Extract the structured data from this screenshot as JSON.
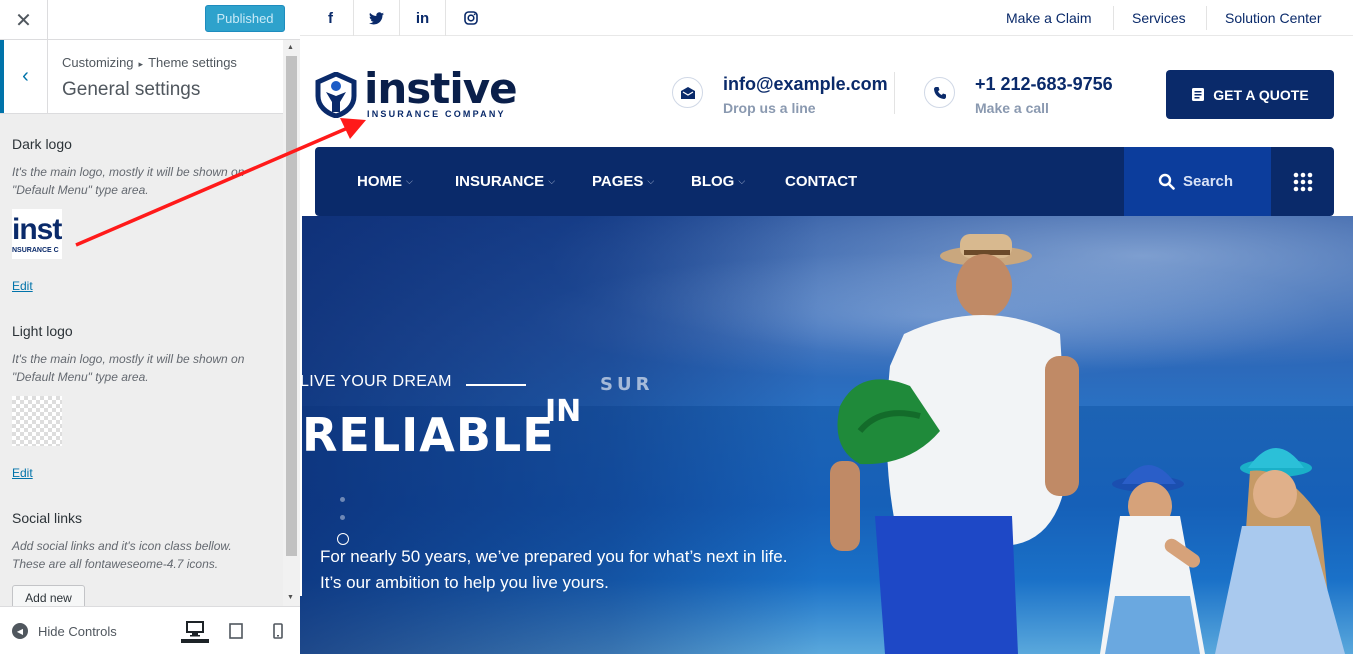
{
  "customizer": {
    "publish_label": "Published",
    "breadcrumb_parent": "Customizing",
    "breadcrumb_child": "Theme settings",
    "panel_title": "General settings",
    "sections": {
      "dark_logo_title": "Dark logo",
      "dark_logo_desc": "It's the main logo, mostly it will be shown on \"Default Menu\" type area.",
      "dark_logo_thumb_big": "insti",
      "dark_logo_thumb_small": "NSURANCE C",
      "light_logo_title": "Light logo",
      "light_logo_desc": "It's the main logo, mostly it will be shown on \"Default Menu\" type area.",
      "edit_label": "Edit",
      "social_title": "Social links",
      "social_desc": "Add social links and it's icon class bellow. These are all fontaweseome-4.7 icons.",
      "add_new_label": "Add new"
    },
    "footer": {
      "hide_controls_label": "Hide Controls"
    }
  },
  "site": {
    "social_icons": [
      "facebook-icon",
      "twitter-icon",
      "linkedin-icon",
      "instagram-icon"
    ],
    "social_glyphs": {
      "facebook": "f",
      "twitter": "🐦",
      "linkedin": "in",
      "instagram": "◎"
    },
    "top_links": [
      "Make a Claim",
      "Services",
      "Solution Center"
    ],
    "logo": {
      "word": "instive",
      "tagline": "INSURANCE COMPANY"
    },
    "contact": {
      "email": "info@example.com",
      "email_sub": "Drop us a line",
      "phone": "+1 212-683-9756",
      "phone_sub": "Make a call"
    },
    "quote_button": "GET A QUOTE",
    "nav": {
      "items": [
        "HOME",
        "INSURANCE",
        "PAGES",
        "BLOG",
        "CONTACT"
      ],
      "search_label": "Search"
    },
    "hero": {
      "kicker": "LIVE YOUR DREAM",
      "title": "RELIABLE",
      "title_anim": "IN",
      "title_anim2": "SUR",
      "line1": "For nearly 50 years, we’ve prepared you for what’s next in life.",
      "line2": "It’s our ambition to help you live yours."
    }
  },
  "colors": {
    "brand_navy": "#0a2a6a",
    "publish_blue": "#2ea2cc",
    "annotation_arrow": "#ff1a1a"
  }
}
